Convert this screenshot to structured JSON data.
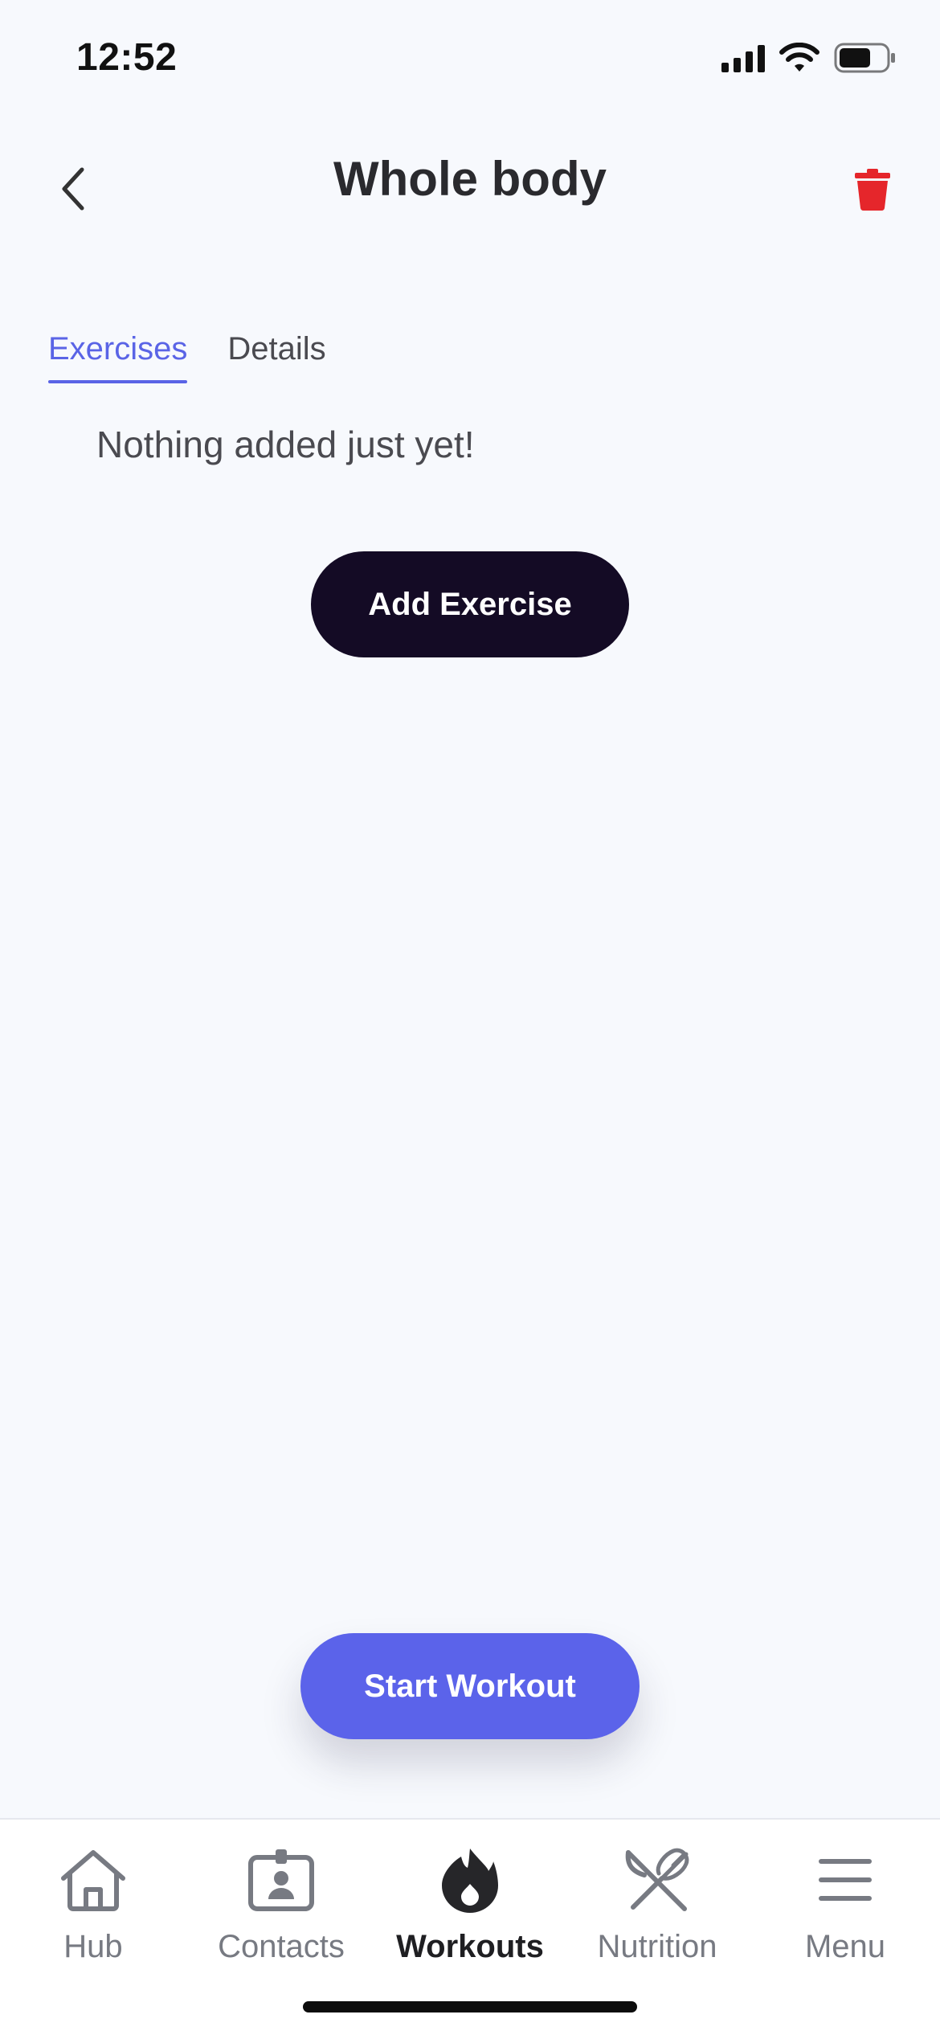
{
  "status_bar": {
    "time": "12:52"
  },
  "header": {
    "title": "Whole body"
  },
  "tabs": [
    {
      "label": "Exercises",
      "active": true
    },
    {
      "label": "Details",
      "active": false
    }
  ],
  "content": {
    "empty_message": "Nothing added just yet!",
    "add_button_label": "Add Exercise"
  },
  "start_button_label": "Start Workout",
  "bottom_nav": {
    "items": [
      {
        "label": "Hub",
        "icon": "home-icon",
        "active": false
      },
      {
        "label": "Contacts",
        "icon": "contact-card-icon",
        "active": false
      },
      {
        "label": "Workouts",
        "icon": "flame-icon",
        "active": true
      },
      {
        "label": "Nutrition",
        "icon": "fork-knife-icon",
        "active": false
      },
      {
        "label": "Menu",
        "icon": "menu-icon",
        "active": false
      }
    ]
  },
  "colors": {
    "accent": "#5a64e6",
    "dark_button": "#140b25",
    "danger": "#e5262b",
    "background": "#f7f9fd"
  }
}
